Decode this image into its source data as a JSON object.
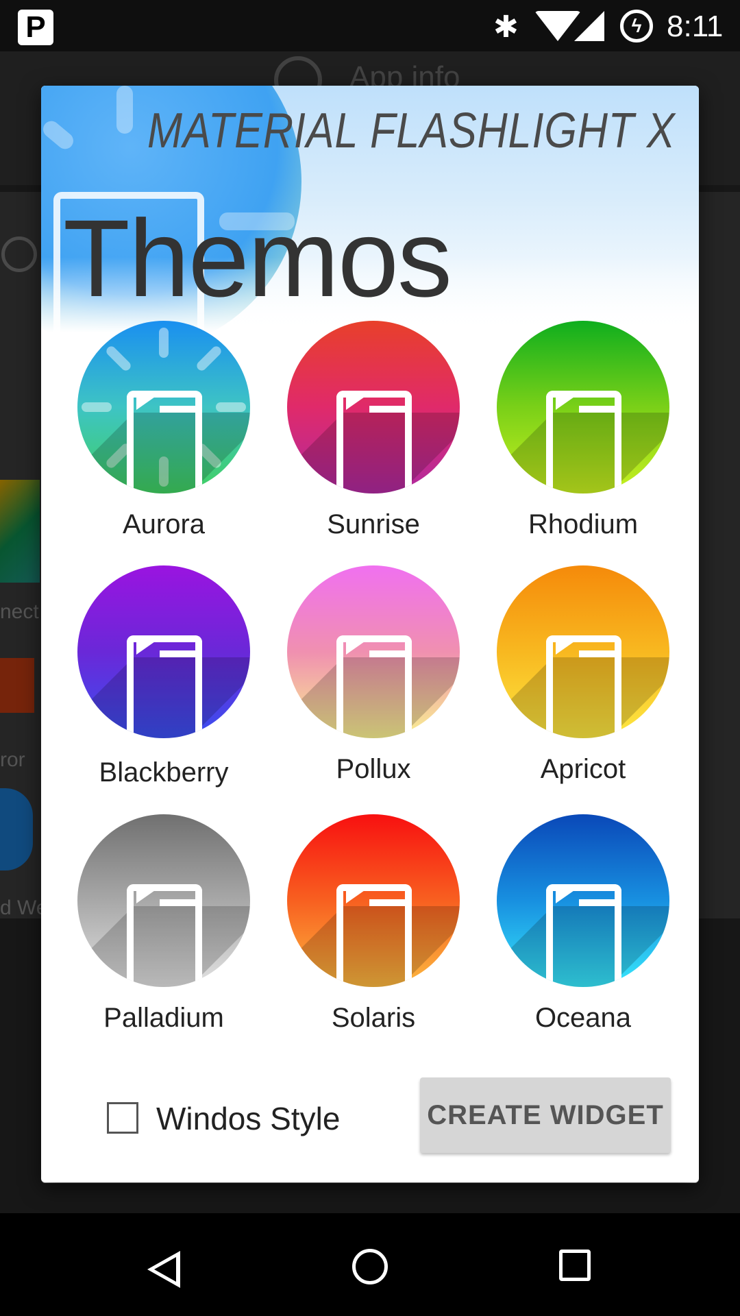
{
  "status_bar": {
    "time": "8:11",
    "icons": [
      "parking-icon",
      "bluetooth-icon",
      "wifi-icon",
      "signal-icon",
      "battery-charging-icon"
    ]
  },
  "background_app": {
    "title": "App info",
    "items": [
      "nect",
      "ror",
      "d Wea"
    ]
  },
  "dialog": {
    "app_name": "MATERIAL FLASHLIGHT X",
    "title": "Themos",
    "themes": [
      {
        "name": "Aurora",
        "colors": [
          "#1a8ff0",
          "#3ec4c4",
          "#40d060"
        ]
      },
      {
        "name": "Sunrise",
        "colors": [
          "#e8402a",
          "#e02a6a",
          "#b02aa0"
        ]
      },
      {
        "name": "Rhodium",
        "colors": [
          "#0fae1e",
          "#7ad018",
          "#c8f020"
        ]
      },
      {
        "name": "Blackberry",
        "colors": [
          "#9a14e0",
          "#6a28d8",
          "#3a50f0"
        ]
      },
      {
        "name": "Pollux",
        "colors": [
          "#f070f0",
          "#f090b0",
          "#f8f090"
        ]
      },
      {
        "name": "Apricot",
        "colors": [
          "#f58a0a",
          "#f8b820",
          "#fde842"
        ]
      },
      {
        "name": "Palladium",
        "colors": [
          "#707070",
          "#a8a8a8",
          "#e2e2e2"
        ]
      },
      {
        "name": "Solaris",
        "colors": [
          "#f81010",
          "#f86020",
          "#fcb840"
        ]
      },
      {
        "name": "Oceana",
        "colors": [
          "#0a48b8",
          "#1890e0",
          "#38e8fc"
        ]
      }
    ],
    "checkbox_label": "Windos Style",
    "checkbox_checked": false,
    "create_button": "CREATE WIDGET"
  },
  "nav_bar": {
    "buttons": [
      "back-icon",
      "home-icon",
      "recents-icon"
    ]
  }
}
